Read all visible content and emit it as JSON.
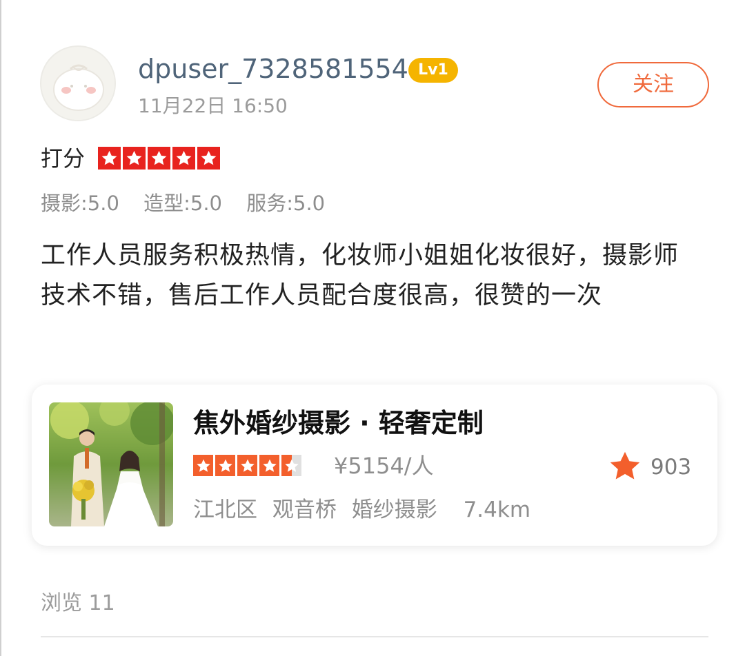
{
  "user": {
    "username": "dpuser_7328581554",
    "level": "Lv1",
    "timestamp": "11月22日  16:50",
    "follow_label": "关注"
  },
  "rating": {
    "label": "打分",
    "stars": 5,
    "sub_scores": [
      "摄影:5.0",
      "造型:5.0",
      "服务:5.0"
    ]
  },
  "review": {
    "text": "工作人员服务积极热情，化妆师小姐姐化妆很好，摄影师技术不错，售后工作人员配合度很高，很赞的一次"
  },
  "shop": {
    "name": "焦外婚纱摄影 · 轻奢定制",
    "stars": 4.5,
    "price": "¥5154/人",
    "hot_count": "903",
    "district": "江北区",
    "area": "观音桥",
    "category": "婚纱摄影",
    "distance": "7.4km"
  },
  "footer": {
    "views": "浏览 11"
  },
  "colors": {
    "accent_orange": "#f06a3c",
    "star_red": "#e8231e",
    "star_orange": "#f35f2c",
    "level_badge": "#f5b400",
    "username": "#4f6479"
  }
}
